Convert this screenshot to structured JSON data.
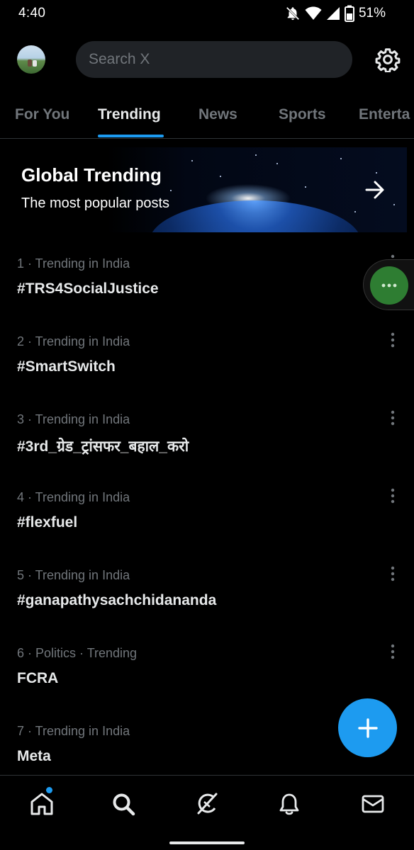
{
  "status_bar": {
    "time": "4:40",
    "battery": "51%",
    "icons": [
      "do-not-disturb-icon",
      "wifi-icon",
      "signal-icon",
      "battery-icon"
    ]
  },
  "header": {
    "search_placeholder": "Search X",
    "avatar_icon": "profile-avatar",
    "settings_icon": "gear-icon"
  },
  "tabs": [
    {
      "label": "For You",
      "active": false
    },
    {
      "label": "Trending",
      "active": true
    },
    {
      "label": "News",
      "active": false
    },
    {
      "label": "Sports",
      "active": false
    },
    {
      "label": "Enterta",
      "active": false
    }
  ],
  "banner": {
    "title": "Global Trending",
    "subtitle": "The most popular posts",
    "icon": "arrow-right-icon"
  },
  "trends": [
    {
      "meta": "1 · Trending in India",
      "name": "#TRS4SocialJustice"
    },
    {
      "meta": "2 · Trending in India",
      "name": "#SmartSwitch"
    },
    {
      "meta": "3 · Trending in India",
      "name": "#3rd_ग्रेड_ट्रांसफर_बहाल_करो"
    },
    {
      "meta": "4 · Trending in India",
      "name": "#flexfuel"
    },
    {
      "meta": "5 · Trending in India",
      "name": "#ganapathysachchidananda"
    },
    {
      "meta": "6 · Politics · Trending",
      "name": "FCRA"
    },
    {
      "meta": "7 · Trending in India",
      "name": "Meta"
    }
  ],
  "fab": {
    "icon": "plus-icon"
  },
  "bottom_nav": [
    "home-icon",
    "search-icon",
    "grok-icon",
    "bell-icon",
    "mail-icon"
  ],
  "colors": {
    "accent": "#1d9bf0",
    "background": "#000000",
    "text_primary": "#e7e9ea",
    "text_secondary": "#71767b",
    "bubble": "#2e7d32"
  }
}
